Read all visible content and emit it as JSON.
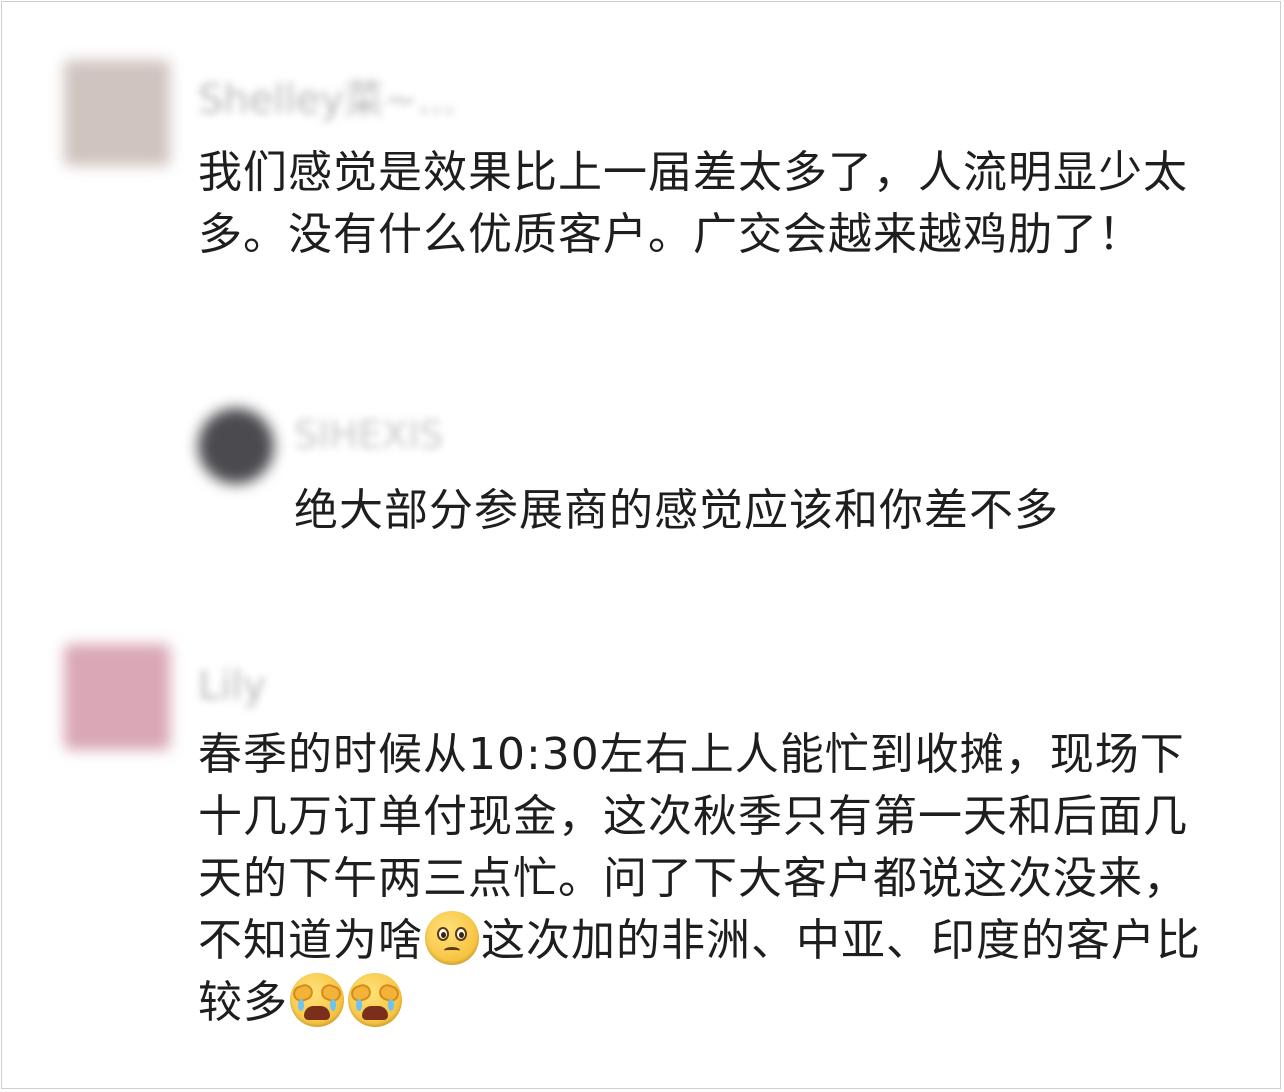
{
  "comments": [
    {
      "username": "Shelley菜~...",
      "avatar_color": "#cfc4bf",
      "text": "我们感觉是效果比上一届差太多了，人流明显少太多。没有什么优质客户。广交会越来越鸡肋了！",
      "reply": {
        "username": "SIHEXIS",
        "avatar_color": "#4b4a4f",
        "text": "绝大部分参展商的感觉应该和你差不多"
      }
    },
    {
      "username": "Lily",
      "avatar_color": "#d9a7b5",
      "text_part1": "春季的时候从10:30左右上人能忙到收摊，现场下十几万订单付现金，这次秋季只有第一天和后面几天的下午两三点忙。问了下大客户都说这次没来，不知道为啥",
      "emoji1": "pleading-face-icon",
      "text_part2": "这次加的非洲、中亚、印度的客户比较多",
      "emoji2": "crying-face-icon",
      "emoji3": "crying-face-icon"
    }
  ]
}
